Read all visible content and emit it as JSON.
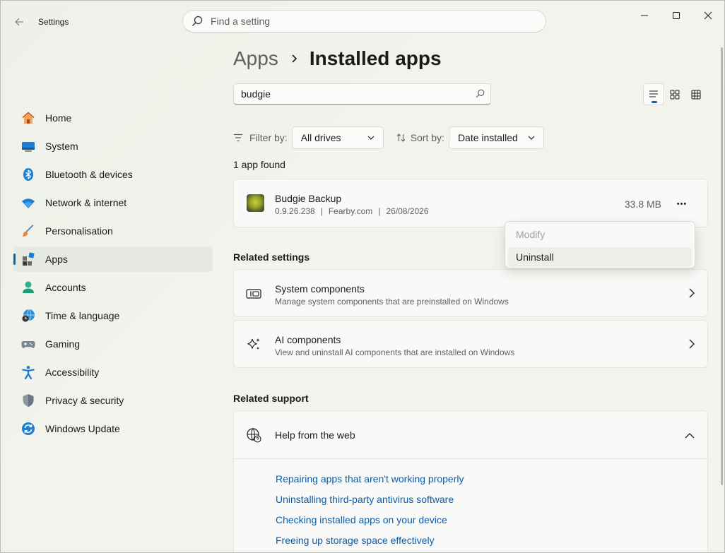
{
  "window": {
    "title": "Settings",
    "accent": "#0067c0"
  },
  "search": {
    "placeholder": "Find a setting",
    "value": ""
  },
  "sidebar": {
    "items": [
      {
        "label": "Home",
        "icon": "home-icon",
        "active": false
      },
      {
        "label": "System",
        "icon": "system-icon",
        "active": false
      },
      {
        "label": "Bluetooth & devices",
        "icon": "bluetooth-icon",
        "active": false
      },
      {
        "label": "Network & internet",
        "icon": "wifi-icon",
        "active": false
      },
      {
        "label": "Personalisation",
        "icon": "brush-icon",
        "active": false
      },
      {
        "label": "Apps",
        "icon": "apps-icon",
        "active": true
      },
      {
        "label": "Accounts",
        "icon": "accounts-icon",
        "active": false
      },
      {
        "label": "Time & language",
        "icon": "globe-clock-icon",
        "active": false
      },
      {
        "label": "Gaming",
        "icon": "gamepad-icon",
        "active": false
      },
      {
        "label": "Accessibility",
        "icon": "accessibility-icon",
        "active": false
      },
      {
        "label": "Privacy & security",
        "icon": "shield-icon",
        "active": false
      },
      {
        "label": "Windows Update",
        "icon": "update-icon",
        "active": false
      }
    ]
  },
  "breadcrumb": {
    "parent": "Apps",
    "current": "Installed apps"
  },
  "app_search": {
    "value": "budgie"
  },
  "filters": {
    "filter_label": "Filter by:",
    "filter_value": "All drives",
    "sort_label": "Sort by:",
    "sort_value": "Date installed"
  },
  "results": {
    "count_text": "1 app found"
  },
  "app": {
    "name": "Budgie Backup",
    "version": "0.9.26.238",
    "publisher": "Fearby.com",
    "date": "26/08/2026",
    "separator": "|",
    "size": "33.8 MB",
    "more_label": "•••"
  },
  "context_menu": {
    "items": [
      {
        "label": "Modify",
        "enabled": false
      },
      {
        "label": "Uninstall",
        "enabled": true
      }
    ]
  },
  "related_settings": {
    "title": "Related settings",
    "items": [
      {
        "title": "System components",
        "desc": "Manage system components that are preinstalled on Windows",
        "icon": "system-components-icon"
      },
      {
        "title": "AI components",
        "desc": "View and uninstall AI components that are installed on Windows",
        "icon": "sparkle-icon"
      }
    ]
  },
  "related_support": {
    "title": "Related support",
    "help_title": "Help from the web",
    "links": [
      "Repairing apps that aren't working properly",
      "Uninstalling third-party antivirus software",
      "Checking installed apps on your device",
      "Freeing up storage space effectively"
    ]
  }
}
